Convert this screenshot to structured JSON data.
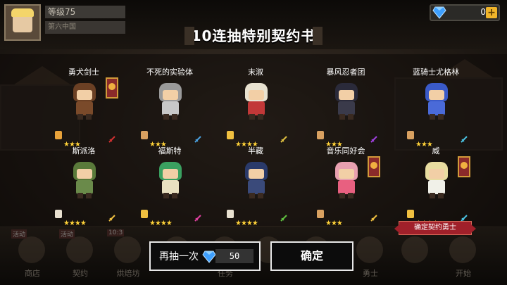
{
  "player": {
    "level_label": "等级75",
    "subtitle": "第六中国"
  },
  "currency": {
    "gem_count": "0",
    "add_label": "+"
  },
  "title": "10连抽特别契约书",
  "heroes": [
    {
      "name": "勇犬剑士",
      "stars": "★★★",
      "hair": "#6b4024",
      "body": "#7a4a2a",
      "scroll": "#e8a23a",
      "weapon": "#d23030",
      "banner": true
    },
    {
      "name": "不死的实验体",
      "stars": "★★★",
      "hair": "#9a9a9a",
      "body": "#c8c8c8",
      "scroll": "#d8a060",
      "weapon": "#4aa0e0",
      "banner": false
    },
    {
      "name": "末淑",
      "stars": "★★★★",
      "hair": "#e8e2d0",
      "body": "#c23838",
      "scroll": "#f0c040",
      "weapon": "#e0c040",
      "banner": false
    },
    {
      "name": "暴风忍者团",
      "stars": "★★★",
      "hair": "#2a2a3a",
      "body": "#3a3a4a",
      "scroll": "#d8a060",
      "weapon": "#a040e0",
      "banner": false
    },
    {
      "name": "蓝骑士尤格林",
      "stars": "★★★",
      "hair": "#3a5ac8",
      "body": "#4a6ad8",
      "scroll": "#d8a060",
      "weapon": "#4ac0e0",
      "banner": false
    },
    {
      "name": "斯派洛",
      "stars": "★★★★",
      "hair": "#5a7a3a",
      "body": "#6a8a4a",
      "scroll": "#e8e0d0",
      "weapon": "#f0c040",
      "banner": false
    },
    {
      "name": "福斯特",
      "stars": "★★★★",
      "hair": "#3aa060",
      "body": "#e8e0c0",
      "scroll": "#f0c040",
      "weapon": "#e040a0",
      "banner": false
    },
    {
      "name": "半藏",
      "stars": "★★★★",
      "hair": "#2a3a6a",
      "body": "#3a4a7a",
      "scroll": "#e8e0d0",
      "weapon": "#60c040",
      "banner": false
    },
    {
      "name": "音乐同好会",
      "stars": "★★★",
      "hair": "#e8a0b0",
      "body": "#e86080",
      "scroll": "#d8a060",
      "weapon": "#f0c040",
      "banner": true
    },
    {
      "name": "威",
      "stars": "★★★★",
      "hair": "#e8dca0",
      "body": "#f0f0e8",
      "scroll": "#f0c040",
      "weapon": "#4ac0e0",
      "banner": true
    }
  ],
  "nav": [
    {
      "label": "商店",
      "tag": "活动"
    },
    {
      "label": "契约",
      "tag": "活动"
    },
    {
      "label": "烘焙坊",
      "tag": "10:3"
    },
    {
      "label": "",
      "tag": ""
    },
    {
      "label": "任务",
      "tag": ""
    },
    {
      "label": "",
      "tag": ""
    },
    {
      "label": "",
      "tag": ""
    },
    {
      "label": "勇士",
      "tag": ""
    },
    {
      "label": "",
      "tag": ""
    },
    {
      "label": "开始",
      "tag": ""
    }
  ],
  "actions": {
    "again_label": "再抽一次",
    "again_cost": "50",
    "confirm_label": "确定",
    "ribbon_label": "确定契约勇士"
  },
  "colors": {
    "star": "#ffd23a",
    "gem": "#3ea0ff",
    "ribbon": "#a0202a"
  }
}
